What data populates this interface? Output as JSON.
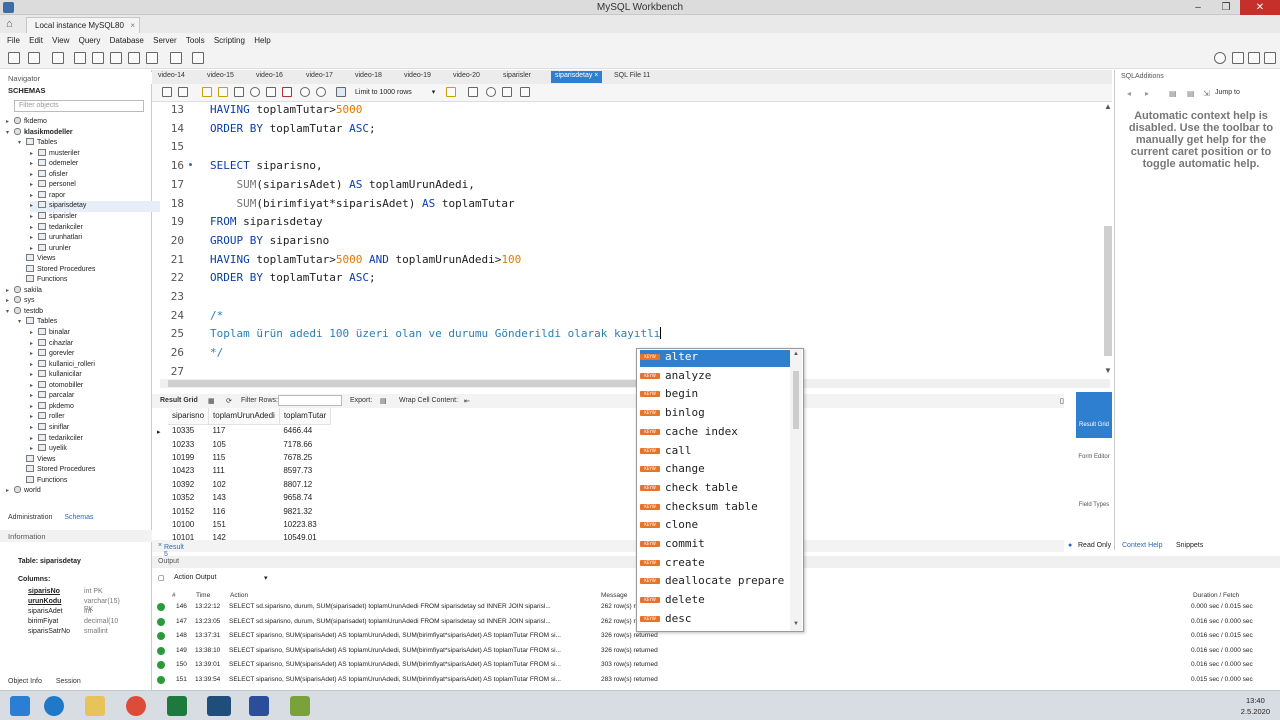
{
  "window": {
    "title": "MySQL Workbench",
    "connection_tab": "Local instance MySQL80"
  },
  "menu": [
    "File",
    "Edit",
    "View",
    "Query",
    "Database",
    "Server",
    "Tools",
    "Scripting",
    "Help"
  ],
  "navigator": {
    "header": "Navigator",
    "schemas_label": "SCHEMAS",
    "filter_placeholder": "Filter objects",
    "tree": [
      {
        "label": "fkdemo",
        "level": 0,
        "kind": "db",
        "tw": "▸"
      },
      {
        "label": "klasikmodeller",
        "level": 0,
        "kind": "db",
        "tw": "▾",
        "bold": true
      },
      {
        "label": "Tables",
        "level": 1,
        "kind": "folder",
        "tw": "▾"
      },
      {
        "label": "musteriler",
        "level": 2,
        "kind": "table",
        "tw": "▸"
      },
      {
        "label": "odemeler",
        "level": 2,
        "kind": "table",
        "tw": "▸"
      },
      {
        "label": "ofisler",
        "level": 2,
        "kind": "table",
        "tw": "▸"
      },
      {
        "label": "personel",
        "level": 2,
        "kind": "table",
        "tw": "▸"
      },
      {
        "label": "rapor",
        "level": 2,
        "kind": "table",
        "tw": "▸"
      },
      {
        "label": "siparisdetay",
        "level": 2,
        "kind": "table",
        "tw": "▸",
        "selected": true
      },
      {
        "label": "siparisler",
        "level": 2,
        "kind": "table",
        "tw": "▸"
      },
      {
        "label": "tedarikciler",
        "level": 2,
        "kind": "table",
        "tw": "▸"
      },
      {
        "label": "urunhatlari",
        "level": 2,
        "kind": "table",
        "tw": "▸"
      },
      {
        "label": "urunler",
        "level": 2,
        "kind": "table",
        "tw": "▸"
      },
      {
        "label": "Views",
        "level": 1,
        "kind": "folder",
        "tw": ""
      },
      {
        "label": "Stored Procedures",
        "level": 1,
        "kind": "folder",
        "tw": ""
      },
      {
        "label": "Functions",
        "level": 1,
        "kind": "folder",
        "tw": ""
      },
      {
        "label": "sakila",
        "level": 0,
        "kind": "db",
        "tw": "▸"
      },
      {
        "label": "sys",
        "level": 0,
        "kind": "db",
        "tw": "▸"
      },
      {
        "label": "testdb",
        "level": 0,
        "kind": "db",
        "tw": "▾"
      },
      {
        "label": "Tables",
        "level": 1,
        "kind": "folder",
        "tw": "▾"
      },
      {
        "label": "binalar",
        "level": 2,
        "kind": "table",
        "tw": "▸"
      },
      {
        "label": "cihazlar",
        "level": 2,
        "kind": "table",
        "tw": "▸"
      },
      {
        "label": "gorevler",
        "level": 2,
        "kind": "table",
        "tw": "▸"
      },
      {
        "label": "kullanici_rolleri",
        "level": 2,
        "kind": "table",
        "tw": "▸"
      },
      {
        "label": "kullanicilar",
        "level": 2,
        "kind": "table",
        "tw": "▸"
      },
      {
        "label": "otomobiller",
        "level": 2,
        "kind": "table",
        "tw": "▸"
      },
      {
        "label": "parcalar",
        "level": 2,
        "kind": "table",
        "tw": "▸"
      },
      {
        "label": "pkdemo",
        "level": 2,
        "kind": "table",
        "tw": "▸"
      },
      {
        "label": "roller",
        "level": 2,
        "kind": "table",
        "tw": "▸"
      },
      {
        "label": "siniflar",
        "level": 2,
        "kind": "table",
        "tw": "▸"
      },
      {
        "label": "tedarikciler",
        "level": 2,
        "kind": "table",
        "tw": "▸"
      },
      {
        "label": "uyelik",
        "level": 2,
        "kind": "table",
        "tw": "▸"
      },
      {
        "label": "Views",
        "level": 1,
        "kind": "folder",
        "tw": ""
      },
      {
        "label": "Stored Procedures",
        "level": 1,
        "kind": "folder",
        "tw": ""
      },
      {
        "label": "Functions",
        "level": 1,
        "kind": "folder",
        "tw": ""
      },
      {
        "label": "world",
        "level": 0,
        "kind": "db",
        "tw": "▸"
      }
    ],
    "admin_tab": "Administration",
    "schemas_tab": "Schemas",
    "info_header": "Information",
    "info": {
      "table_line": "Table: siparisdetay",
      "columns_label": "Columns:",
      "columns": [
        {
          "name": "siparisNo",
          "type": "int PK",
          "bold": true
        },
        {
          "name": "urunKodu",
          "type": "varchar(15)",
          "extra": "PK",
          "bold": true
        },
        {
          "name": "siparisAdet",
          "type": "int"
        },
        {
          "name": "birimFiyat",
          "type": "decimal(10"
        },
        {
          "name": "siparisSatrNo",
          "type": "smallint"
        }
      ]
    },
    "object_info_tab": "Object Info",
    "session_tab": "Session"
  },
  "editor_tabs": [
    "video-14",
    "video-15",
    "video-16",
    "video-17",
    "video-18",
    "video-19",
    "video-20",
    "siparisler",
    "siparisdetay",
    "SQL File 11"
  ],
  "active_tab_index": 8,
  "editor_toolbar": {
    "limit_label": "Limit to 1000 rows"
  },
  "code_lines": [
    {
      "n": "13",
      "tokens": [
        {
          "t": "HAVING",
          "c": "kw"
        },
        {
          "t": " toplamTutar>"
        },
        {
          "t": "5000",
          "c": "num"
        }
      ]
    },
    {
      "n": "14",
      "tokens": [
        {
          "t": "ORDER BY",
          "c": "kw"
        },
        {
          "t": " toplamTutar "
        },
        {
          "t": "ASC",
          "c": "kw"
        },
        {
          "t": ";"
        }
      ]
    },
    {
      "n": "15",
      "tokens": []
    },
    {
      "n": "16",
      "dot": true,
      "tokens": [
        {
          "t": "SELECT",
          "c": "kw"
        },
        {
          "t": " siparisno,"
        }
      ]
    },
    {
      "n": "17",
      "tokens": [
        {
          "t": "    "
        },
        {
          "t": "SUM",
          "c": "fn"
        },
        {
          "t": "(siparisAdet) "
        },
        {
          "t": "AS",
          "c": "kw"
        },
        {
          "t": " toplamUrunAdedi,"
        }
      ]
    },
    {
      "n": "18",
      "tokens": [
        {
          "t": "    "
        },
        {
          "t": "SUM",
          "c": "fn"
        },
        {
          "t": "(birimfiyat*siparisAdet) "
        },
        {
          "t": "AS",
          "c": "kw"
        },
        {
          "t": " toplamTutar"
        }
      ]
    },
    {
      "n": "19",
      "tokens": [
        {
          "t": "FROM",
          "c": "kw"
        },
        {
          "t": " siparisdetay"
        }
      ]
    },
    {
      "n": "20",
      "tokens": [
        {
          "t": "GROUP BY",
          "c": "kw"
        },
        {
          "t": " siparisno"
        }
      ]
    },
    {
      "n": "21",
      "tokens": [
        {
          "t": "HAVING",
          "c": "kw"
        },
        {
          "t": " toplamTutar>"
        },
        {
          "t": "5000",
          "c": "num"
        },
        {
          "t": " "
        },
        {
          "t": "AND",
          "c": "kw"
        },
        {
          "t": " toplamUrunAdedi>"
        },
        {
          "t": "100",
          "c": "num"
        }
      ]
    },
    {
      "n": "22",
      "tokens": [
        {
          "t": "ORDER BY",
          "c": "kw"
        },
        {
          "t": " toplamTutar "
        },
        {
          "t": "ASC",
          "c": "kw"
        },
        {
          "t": ";"
        }
      ]
    },
    {
      "n": "23",
      "tokens": []
    },
    {
      "n": "24",
      "tokens": [
        {
          "t": "/*",
          "c": "cmt"
        }
      ]
    },
    {
      "n": "25",
      "caret": true,
      "tokens": [
        {
          "t": "Toplam ürün adedi 100 üzeri olan ve durumu Gönderildi olarak kayıtlı",
          "c": "cmt"
        }
      ]
    },
    {
      "n": "26",
      "tokens": [
        {
          "t": "*/",
          "c": "cmt"
        }
      ]
    },
    {
      "n": "27",
      "tokens": []
    }
  ],
  "autocomplete": {
    "badge": "KEYW",
    "items": [
      "alter",
      "analyze",
      "begin",
      "binlog",
      "cache index",
      "call",
      "change",
      "check table",
      "checksum table",
      "clone",
      "commit",
      "create",
      "deallocate prepare",
      "delete",
      "desc"
    ],
    "selected_index": 0
  },
  "result_toolbar": {
    "result_grid": "Result Grid",
    "filter_rows": "Filter Rows:",
    "export": "Export:",
    "wrap": "Wrap Cell Content:"
  },
  "result_grid": {
    "columns": [
      "siparisno",
      "toplamUrunAdedi",
      "toplamTutar"
    ],
    "rows": [
      [
        "10335",
        "117",
        "6466.44"
      ],
      [
        "10233",
        "105",
        "7178.66"
      ],
      [
        "10199",
        "115",
        "7678.25"
      ],
      [
        "10423",
        "111",
        "8597.73"
      ],
      [
        "10392",
        "102",
        "8807.12"
      ],
      [
        "10352",
        "143",
        "9658.74"
      ],
      [
        "10152",
        "116",
        "9821.32"
      ],
      [
        "10100",
        "151",
        "10223.83"
      ],
      [
        "10101",
        "142",
        "10549.01"
      ]
    ]
  },
  "result_tab": "Result 5",
  "result_side": {
    "grid": "Result Grid",
    "form": "Form Editor",
    "field": "Field Types",
    "read_only": "Read Only",
    "context_help": "Context Help",
    "snippets": "Snippets"
  },
  "sqladditions": {
    "header": "SQLAdditions",
    "jump": "Jump to",
    "help": "Automatic context help is disabled. Use the toolbar to manually get help for the current caret position or to toggle automatic help."
  },
  "output": {
    "header": "Output",
    "action_output": "Action Output",
    "cols": [
      "#",
      "Time",
      "Action",
      "Message",
      "Duration / Fetch"
    ],
    "rows": [
      {
        "n": "146",
        "time": "13:22:12",
        "action": "SELECT  sd.siparisno,      durum,      SUM(siparisadet) toplamUrunAdedi  FROM siparisdetay sd INNER JOIN siparisl...",
        "msg": "262 row(s) returned",
        "dur": "0.000 sec / 0.015 sec"
      },
      {
        "n": "147",
        "time": "13:23:05",
        "action": "SELECT  sd.siparisno,      durum,      SUM(siparisadet) toplamUrunAdedi  FROM siparisdetay sd INNER JOIN siparisl...",
        "msg": "262 row(s) returned",
        "dur": "0.016 sec / 0.000 sec"
      },
      {
        "n": "148",
        "time": "13:37:31",
        "action": "SELECT siparisno, SUM(siparisAdet) AS toplamUrunAdedi,      SUM(birimfiyat*siparisAdet) AS toplamTutar FROM si...",
        "msg": "326 row(s) returned",
        "dur": "0.016 sec / 0.015 sec"
      },
      {
        "n": "149",
        "time": "13:38:10",
        "action": "SELECT siparisno, SUM(siparisAdet) AS toplamUrunAdedi,      SUM(birimfiyat*siparisAdet) AS toplamTutar FROM si...",
        "msg": "326 row(s) returned",
        "dur": "0.016 sec / 0.000 sec"
      },
      {
        "n": "150",
        "time": "13:39:01",
        "action": "SELECT siparisno, SUM(siparisAdet) AS toplamUrunAdedi,      SUM(birimfiyat*siparisAdet) AS toplamTutar FROM si...",
        "msg": "303 row(s) returned",
        "dur": "0.016 sec / 0.000 sec"
      },
      {
        "n": "151",
        "time": "13:39:54",
        "action": "SELECT siparisno, SUM(siparisAdet) AS toplamUrunAdedi,      SUM(birimfiyat*siparisAdet) AS toplamTutar FROM si...",
        "msg": "283 row(s) returned",
        "dur": "0.015 sec / 0.000 sec"
      }
    ]
  },
  "clock": {
    "time": "13:40",
    "date": "2.5.2020"
  },
  "colors": {
    "accent": "#2f7fd0",
    "keyword": "#0a3ea8",
    "number": "#e07a00",
    "comment": "#2a7fb8",
    "ok": "#2a9a3a",
    "close": "#c7302a"
  }
}
